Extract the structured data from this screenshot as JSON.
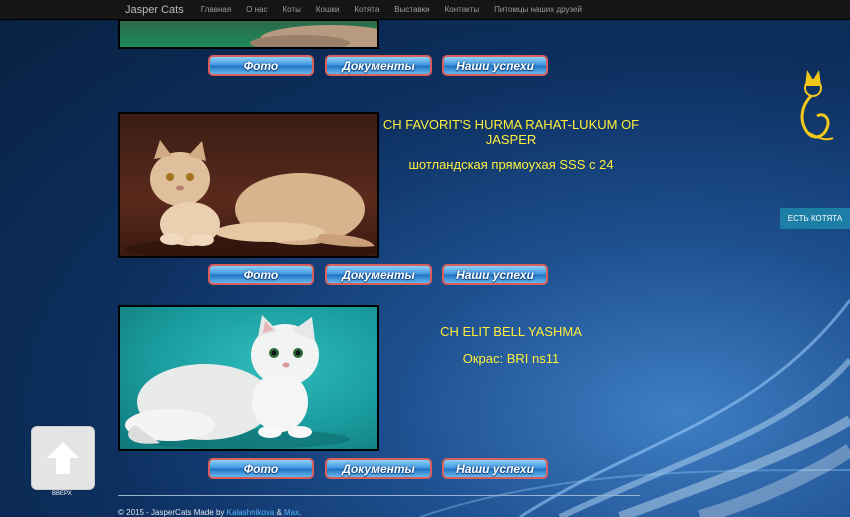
{
  "nav": {
    "brand": "Jasper Cats",
    "items": [
      "Главная",
      "О нас",
      "Коты",
      "Кошки",
      "Котята",
      "Выставки",
      "Контакты",
      "Питомцы наших друзей"
    ]
  },
  "buttons": {
    "photo": "Фото",
    "documents": "Документы",
    "achievements": "Наши успехи"
  },
  "cats": [
    {
      "name": "CH FAVORIT'S HURMA RAHAT-LUKUM OF JASPER",
      "info": "шотландская прямоухая SSS с 24"
    },
    {
      "name": "CH ELIT BELL YASHMA",
      "info": "Окрас: BRI ns11"
    }
  ],
  "side_button": "ЕСТЬ КОТЯТА",
  "up_label": "ВВЕРХ",
  "footer": {
    "text": "© 2015 - JasperCats Made by ",
    "link1": "Kalashnikova",
    "sep": " & ",
    "link2": "Max",
    "end": "."
  },
  "colors": {
    "accent_yellow": "#ffef3b",
    "nav_bg": "#151515",
    "button_border": "#d9605a"
  }
}
